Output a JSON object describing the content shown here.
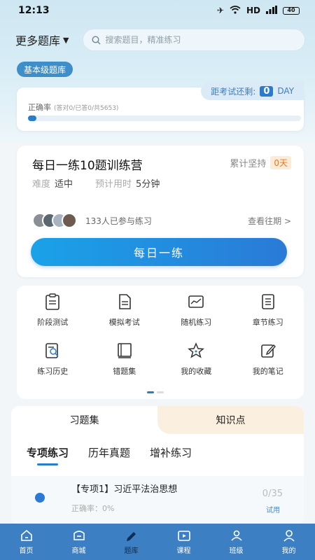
{
  "status_bar": {
    "time": "12:13",
    "battery": "40"
  },
  "header": {
    "bank_select": "更多题库",
    "search_placeholder": "搜索题目，精准练习"
  },
  "level_badge": "基本级题库",
  "progress": {
    "countdown_label": "距考试还剩:",
    "countdown_days": "0",
    "countdown_unit": "DAY",
    "accuracy_label": "正确率",
    "accuracy_detail": "(答对0/已答0/共5653)",
    "fill_fraction": 0.0
  },
  "daily": {
    "title": "每日一练10题训练营",
    "streak_label": "累计坚持",
    "streak_days": "0天",
    "difficulty_label": "难度",
    "difficulty_value": "适中",
    "time_label": "预计用时",
    "time_value": "5分钟",
    "participants": "133人已参与练习",
    "history_link": "查看往期 >",
    "button": "每日一练"
  },
  "grid": [
    {
      "label": "阶段测试",
      "icon": "clipboard-icon"
    },
    {
      "label": "模拟考试",
      "icon": "document-icon"
    },
    {
      "label": "随机练习",
      "icon": "chart-icon"
    },
    {
      "label": "章节练习",
      "icon": "list-icon"
    },
    {
      "label": "练习历史",
      "icon": "history-search-icon"
    },
    {
      "label": "错题集",
      "icon": "book-icon"
    },
    {
      "label": "我的收藏",
      "icon": "star-icon"
    },
    {
      "label": "我的笔记",
      "icon": "edit-icon"
    }
  ],
  "sets": {
    "tabs": [
      "习题集",
      "知识点"
    ],
    "sub_tabs": [
      "专项练习",
      "历年真题",
      "增补练习"
    ],
    "item": {
      "title": "【专项1】习近平法治思想",
      "accuracy": "正确率：0%",
      "count": "0/35",
      "trial": "试用"
    }
  },
  "nav": [
    "首页",
    "商城",
    "题库",
    "课程",
    "班级",
    "我的"
  ],
  "colors": {
    "primary": "#2a7ec8",
    "nav_bg": "#3c7fc2",
    "streak": "#e07b28"
  }
}
